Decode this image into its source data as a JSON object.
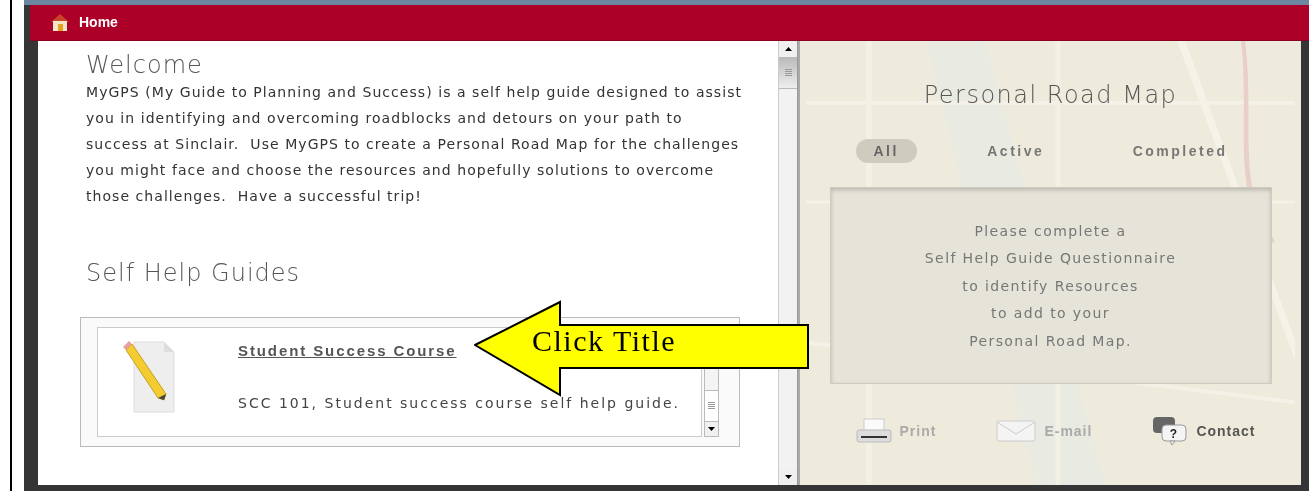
{
  "header": {
    "title": "Home"
  },
  "welcome": {
    "heading": "Welcome",
    "text": "MyGPS (My Guide to Planning and Success) is a self help guide designed to assist you in identifying and overcoming roadblocks and detours on your path to success at Sinclair.  Use MyGPS to create a Personal Road Map for the challenges you might face and choose the resources and hopefully solutions to overcome those challenges.  Have a successful trip!"
  },
  "guides": {
    "heading": "Self Help Guides",
    "items": [
      {
        "title": "Student Success Course",
        "description": "SCC 101, Student success course self help guide."
      }
    ]
  },
  "road_map": {
    "title": "Personal Road Map",
    "filters": [
      {
        "label": "All",
        "selected": true
      },
      {
        "label": "Active",
        "selected": false
      },
      {
        "label": "Completed",
        "selected": false
      }
    ],
    "message": [
      "Please complete a",
      "Self Help Guide Questionnaire",
      "to identify Resources",
      "to add to your",
      "Personal Road Map."
    ],
    "actions": [
      {
        "kind": "print",
        "label": "Print",
        "disabled": true
      },
      {
        "kind": "email",
        "label": "E-mail",
        "disabled": true
      },
      {
        "kind": "contact",
        "label": "Contact",
        "disabled": false,
        "icon_glyph": "?"
      }
    ]
  },
  "callout": {
    "text": "Click Title"
  }
}
